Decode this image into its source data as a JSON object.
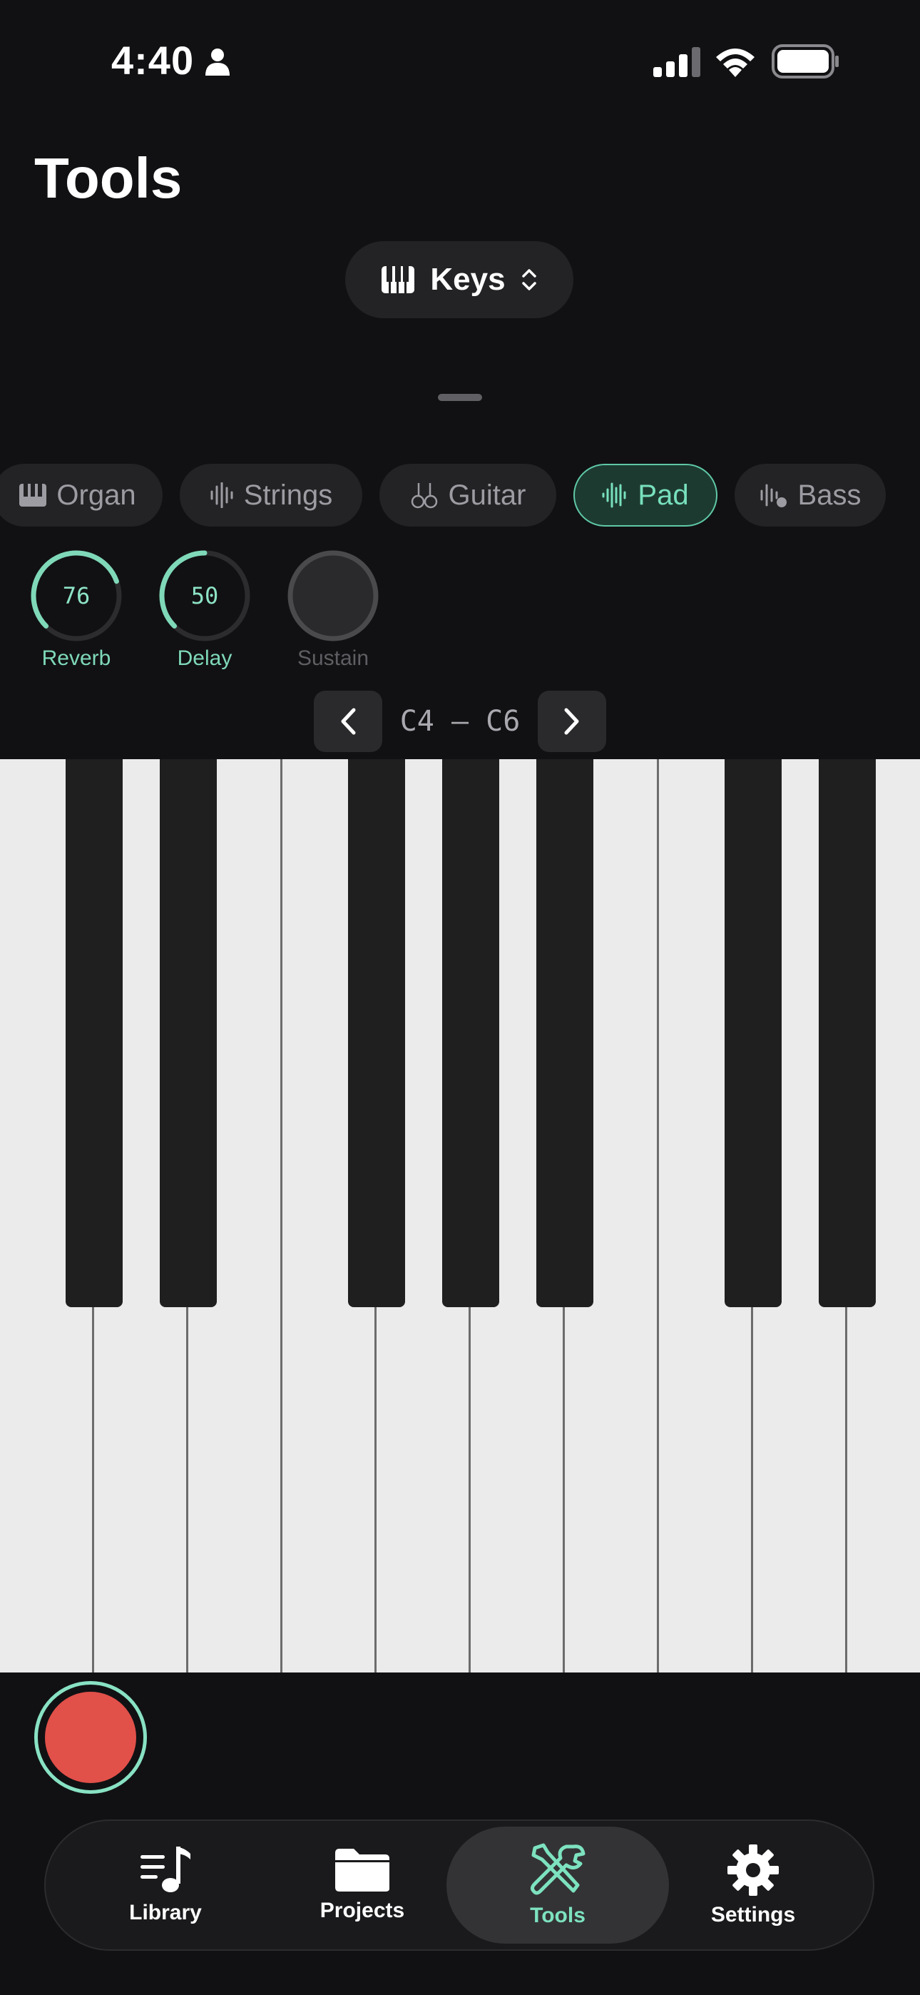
{
  "status_bar": {
    "time": "4:40"
  },
  "header": {
    "title": "Tools"
  },
  "instrument_selector": {
    "label": "Keys"
  },
  "tones": [
    {
      "label": "Organ",
      "icon": "piano-icon",
      "active": false
    },
    {
      "label": "Strings",
      "icon": "waveform-icon",
      "active": false
    },
    {
      "label": "Guitar",
      "icon": "guitars-icon",
      "active": false
    },
    {
      "label": "Pad",
      "icon": "waveform-icon",
      "active": true
    },
    {
      "label": "Bass",
      "icon": "waveform-badge-icon",
      "active": false
    }
  ],
  "knobs": [
    {
      "label": "Reverb",
      "value": "76"
    },
    {
      "label": "Delay",
      "value": "50"
    },
    {
      "label": "Sustain",
      "value": ""
    }
  ],
  "range": {
    "text": "C4 — C6"
  },
  "tab_bar": {
    "items": [
      {
        "label": "Library",
        "icon": "music-list-icon"
      },
      {
        "label": "Projects",
        "icon": "folder-icon"
      },
      {
        "label": "Tools",
        "icon": "tools-icon",
        "active": true
      },
      {
        "label": "Settings",
        "icon": "gear-icon"
      }
    ]
  },
  "colors": {
    "accent": "#78e0bd",
    "record": "#e2504a",
    "background": "#111113"
  }
}
